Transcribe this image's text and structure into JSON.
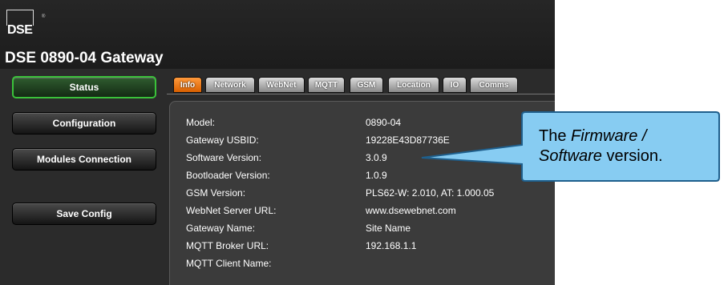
{
  "header": {
    "logo_text": "DSE",
    "logo_mark": "®",
    "title": "DSE 0890-04 Gateway"
  },
  "sidebar": {
    "items": [
      {
        "label": "Status",
        "active": true
      },
      {
        "label": "Configuration",
        "active": false
      },
      {
        "label": "Modules Connection",
        "active": false
      },
      {
        "label": "Save Config",
        "active": false
      }
    ]
  },
  "tabs": [
    {
      "label": "Info",
      "active": true
    },
    {
      "label": "Network",
      "active": false
    },
    {
      "label": "WebNet",
      "active": false
    },
    {
      "label": "MQTT",
      "active": false
    },
    {
      "label": "GSM",
      "active": false
    },
    {
      "label": "Location",
      "active": false
    },
    {
      "label": "IO",
      "active": false
    },
    {
      "label": "Comms",
      "active": false
    }
  ],
  "info": {
    "rows": [
      {
        "label": "Model:",
        "value": "0890-04"
      },
      {
        "label": "Gateway USBID:",
        "value": "19228E43D87736E"
      },
      {
        "label": "Software Version:",
        "value": "3.0.9"
      },
      {
        "label": "Bootloader Version:",
        "value": "1.0.9"
      },
      {
        "label": "GSM Version:",
        "value": "PLS62-W: 2.010, AT: 1.000.05"
      },
      {
        "label": "WebNet Server URL:",
        "value": "www.dsewebnet.com"
      },
      {
        "label": "Gateway Name:",
        "value": "Site Name"
      },
      {
        "label": "MQTT Broker URL:",
        "value": "192.168.1.1"
      },
      {
        "label": "MQTT Client Name:",
        "value": ""
      }
    ]
  },
  "callout": {
    "line1_prefix": "The ",
    "line1_em": "Firmware /",
    "line2_em": "Software",
    "line2_suffix": " version."
  },
  "colors": {
    "active_tab": "#e8740c",
    "active_nav_border": "#3ac23a",
    "callout_fill": "#87ccf2",
    "callout_stroke": "#1f5f8c"
  }
}
